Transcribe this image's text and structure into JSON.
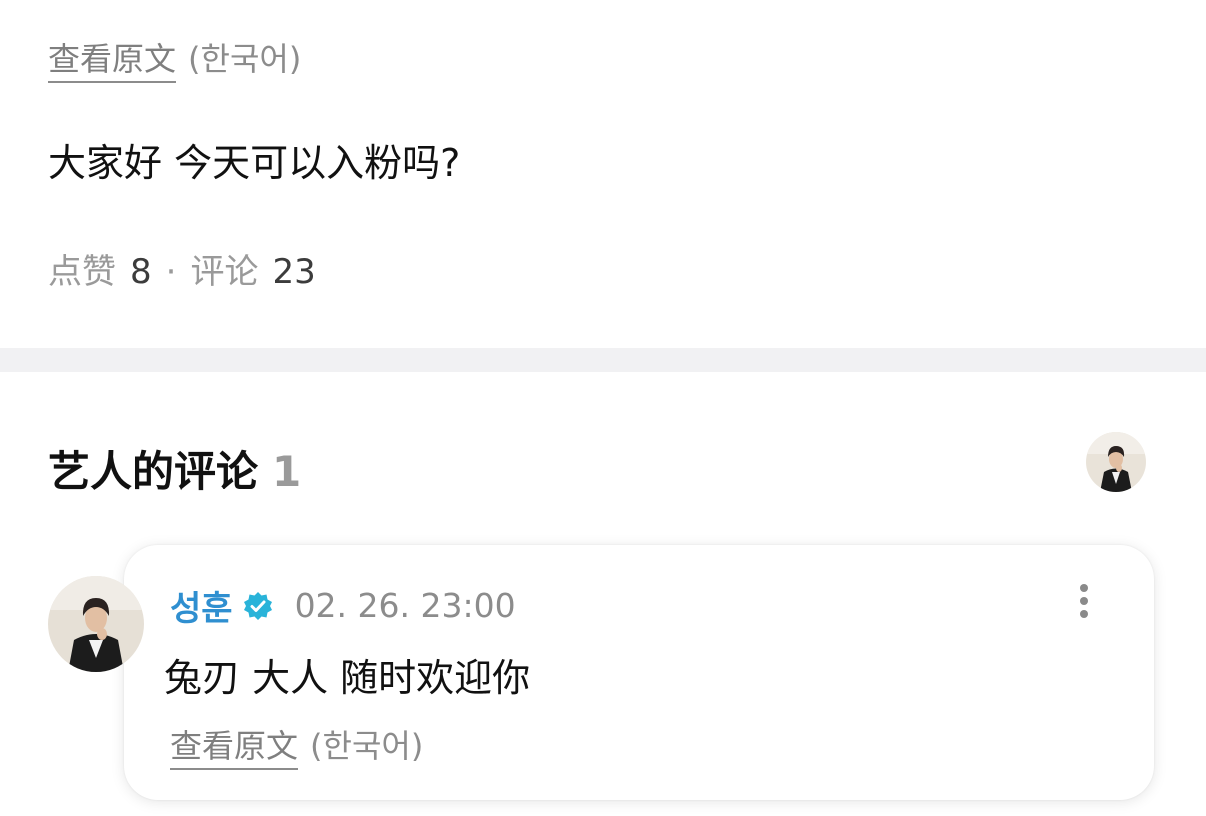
{
  "post": {
    "translate_link": "查看原文",
    "translate_lang": "(한국어)",
    "text": "大家好 今天可以入粉吗?",
    "likes_label": "点赞",
    "likes_count": "8",
    "separator": "·",
    "comments_label": "评论",
    "comments_count": "23"
  },
  "artist_comments": {
    "title": "艺人的评论",
    "count": "1",
    "header_avatar_icon": "artist-avatar"
  },
  "comment": {
    "author": "성훈",
    "verified_icon": "verified-badge-icon",
    "timestamp": "02. 26. 23:00",
    "text": "兔刃 大人 随时欢迎你",
    "translate_link": "查看原文",
    "translate_lang": "(한국어)",
    "more_icon": "more-vertical-icon"
  },
  "colors": {
    "author_blue": "#2f8fd0",
    "verified_teal": "#29b3d9",
    "muted_gray": "#8c8c8c",
    "divider_gray": "#f1f1f3"
  }
}
